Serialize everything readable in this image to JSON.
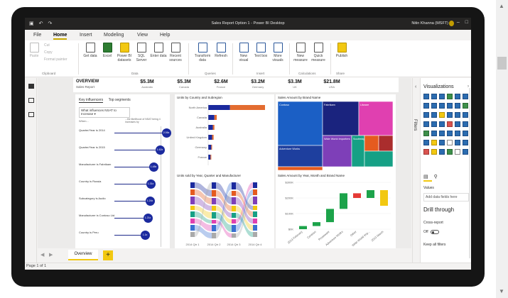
{
  "window": {
    "title": "Sales Report Option 1 - Power BI Desktop",
    "user": "Nitin Khanna (MSFT)"
  },
  "menu": {
    "tabs": [
      "File",
      "Home",
      "Insert",
      "Modeling",
      "View",
      "Help"
    ],
    "active": "Home"
  },
  "ribbon": {
    "clipboard": {
      "paste": "Paste",
      "cut": "Cut",
      "copy": "Copy",
      "format_painter": "Format painter",
      "group": "Clipboard"
    },
    "data": {
      "get_data": "Get data",
      "excel": "Excel",
      "power_bi_datasets": "Power BI datasets",
      "sql_server": "SQL Server",
      "enter_data": "Enter data",
      "recent_sources": "Recent sources",
      "group": "Data"
    },
    "queries": {
      "transform_data": "Transform data",
      "refresh": "Refresh",
      "group": "Queries"
    },
    "insert": {
      "new_visual": "New visual",
      "text_box": "Text box",
      "more_visuals": "More visuals",
      "group": "Insert"
    },
    "calculations": {
      "new_measure": "New measure",
      "quick_measure": "Quick measure",
      "group": "Calculations"
    },
    "share": {
      "publish": "Publish",
      "group": "Share"
    }
  },
  "overview": {
    "title": "OVERVIEW",
    "subtitle": "Sales Report",
    "kpis": [
      {
        "value": "$5.3M",
        "label": "Australia"
      },
      {
        "value": "$5.3M",
        "label": "Canada"
      },
      {
        "value": "$2.6M",
        "label": "France"
      },
      {
        "value": "$3.2M",
        "label": "Germany"
      },
      {
        "value": "$3.3M",
        "label": "UK"
      },
      {
        "value": "$21.8M",
        "label": "USA"
      }
    ]
  },
  "key_influencers": {
    "tabs": [
      "Key influencers",
      "Top segments"
    ],
    "question": "What influences NSAT to Increase ▾",
    "col_left": "When...",
    "col_right": "...the likelihood of NSAT being 4 increases by",
    "rows": [
      {
        "label": "Quarter/Year is 2014",
        "value": "2.06x",
        "pct": 1.0
      },
      {
        "label": "Quarter/Year is 2015",
        "value": "1.62x",
        "pct": 0.82
      },
      {
        "label": "Manufacturer is Fabrikam",
        "value": "1.48x",
        "pct": 0.65
      },
      {
        "label": "Country is Russia",
        "value": "1.31x",
        "pct": 0.57
      },
      {
        "label": "Subcategory is Audio",
        "value": "1.24x",
        "pct": 0.55
      },
      {
        "label": "Manufacturer is Contoso Ltd",
        "value": "1.21x",
        "pct": 0.5
      },
      {
        "label": "Country is Peru",
        "value": "1.1x",
        "pct": 0.42
      }
    ]
  },
  "chart_titles": {
    "country_subregion": "Units by Country and Subregion",
    "brand_treemap": "Sales Amount by Brand Name",
    "sankey": "Units sold by Year, Quarter and Manufacturer",
    "waterfall": "Sales Amount by Year, Month and Brand Name"
  },
  "chart_data": [
    {
      "type": "bar",
      "title": "Units by Country and Subregion",
      "categories": [
        "North America",
        "Canada",
        "Australia",
        "United Kingdom",
        "Germany",
        "France"
      ],
      "series": [
        {
          "name": "",
          "color": "#1b2a9e",
          "values": [
            28,
            8,
            6,
            5,
            4,
            3
          ]
        },
        {
          "name": "",
          "color": "#e36c30",
          "values": [
            45,
            3,
            2,
            2,
            1,
            1
          ]
        }
      ]
    },
    {
      "type": "heatmap",
      "title": "Sales Amount by Brand Name",
      "tiles": [
        {
          "label": "Contoso",
          "value": 30,
          "color": "#1b5fc5"
        },
        {
          "label": "Fabrikam",
          "value": 14,
          "color": "#1a237e"
        },
        {
          "label": "Litware",
          "value": 14,
          "color": "#e040b0"
        },
        {
          "label": "Adventure Works",
          "value": 12,
          "color": "#1e3f9e"
        },
        {
          "label": "Wide World Importers",
          "value": 8,
          "color": "#7e3fb8"
        },
        {
          "label": "Proseware",
          "value": 11,
          "color": "#e55b1f"
        },
        {
          "label": "Southridge Video",
          "value": 5,
          "color": "#16a085"
        }
      ]
    },
    {
      "type": "area",
      "title": "Units sold by Year, Quarter and Manufacturer",
      "categories": [
        "2014 Qtr 1",
        "2014 Qtr 2",
        "2014 Qtr 3",
        "2014 Qtr 4"
      ]
    },
    {
      "type": "bar",
      "title": "Sales Amount by Year, Month and Brand Name",
      "y_ticks": [
        "$300K",
        "$200K",
        "$100K",
        "$0K"
      ],
      "x_labels": [
        "2013 February",
        "Contoso",
        "Proseware",
        "Adventure Works",
        "Other",
        "Wide World Imp...",
        "2013 March"
      ],
      "bars": [
        {
          "start": 0,
          "end": 20,
          "color": "#1ca34a"
        },
        {
          "start": 20,
          "end": 45,
          "color": "#1ca34a"
        },
        {
          "start": 45,
          "end": 130,
          "color": "#1ca34a"
        },
        {
          "start": 130,
          "end": 230,
          "color": "#1ca34a"
        },
        {
          "start": 230,
          "end": 200,
          "color": "#e53935"
        },
        {
          "start": 200,
          "end": 250,
          "color": "#1ca34a"
        },
        {
          "start": 250,
          "end": 150,
          "color": "#f2c811"
        }
      ]
    }
  ],
  "pages": {
    "tab": "Overview",
    "add": "+",
    "status": "Page 1 of 1"
  },
  "filters_pane": {
    "label": "Filters"
  },
  "viz_pane": {
    "title": "Visualizations",
    "values": "Values",
    "add_fields": "Add data fields here",
    "drill": "Drill through",
    "cross_report": "Cross-report",
    "off": "Off",
    "keep_filters": "Keep all filters"
  }
}
